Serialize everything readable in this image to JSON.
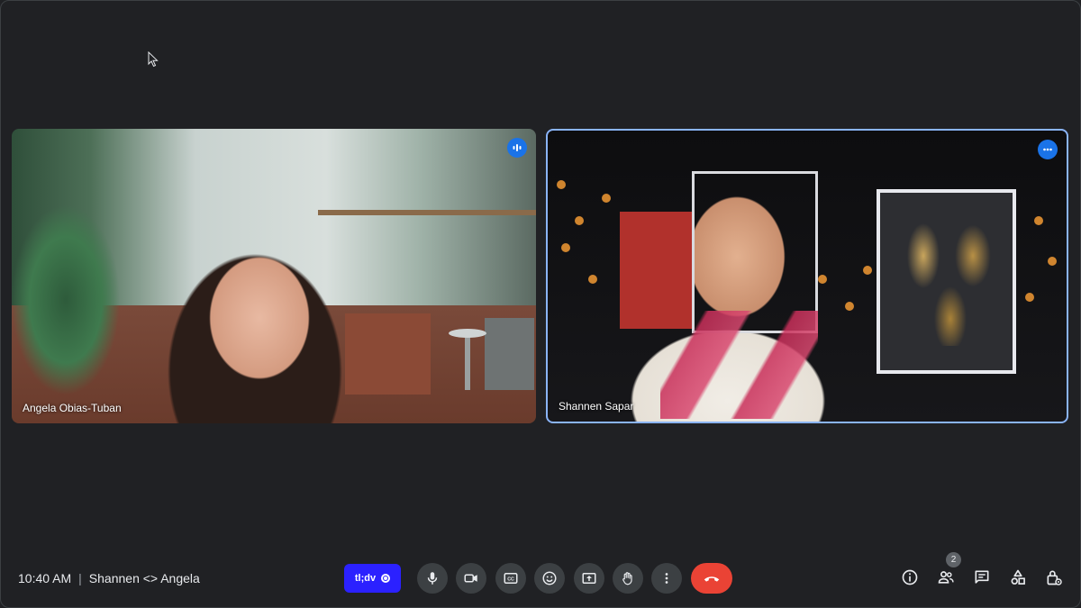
{
  "participants": [
    {
      "name": "Angela Obias-Tuban",
      "badge_icon": "speaking-indicator-icon"
    },
    {
      "name": "Shannen Sapar",
      "badge_icon": "more-options-icon",
      "active_speaker": true
    }
  ],
  "meeting": {
    "time": "10:40 AM",
    "separator": "|",
    "title": "Shannen <> Angela"
  },
  "extension": {
    "label": "tl;dv",
    "icon": "record-icon",
    "color": "#2b21ff"
  },
  "controls": [
    {
      "name": "microphone",
      "icon": "mic-icon"
    },
    {
      "name": "camera",
      "icon": "camera-icon"
    },
    {
      "name": "captions",
      "icon": "captions-icon"
    },
    {
      "name": "reactions",
      "icon": "emoji-icon"
    },
    {
      "name": "present",
      "icon": "present-screen-icon"
    },
    {
      "name": "raise-hand",
      "icon": "hand-icon"
    },
    {
      "name": "more-options",
      "icon": "more-vert-icon"
    },
    {
      "name": "leave-call",
      "icon": "end-call-icon",
      "color": "#ea4335"
    }
  ],
  "side_panel": {
    "people_count": "2",
    "icons": [
      "info-icon",
      "people-icon",
      "chat-icon",
      "activities-icon",
      "host-controls-icon"
    ]
  },
  "colors": {
    "background": "#202124",
    "active_border": "#8ab4f8",
    "accent": "#1a73e8"
  }
}
